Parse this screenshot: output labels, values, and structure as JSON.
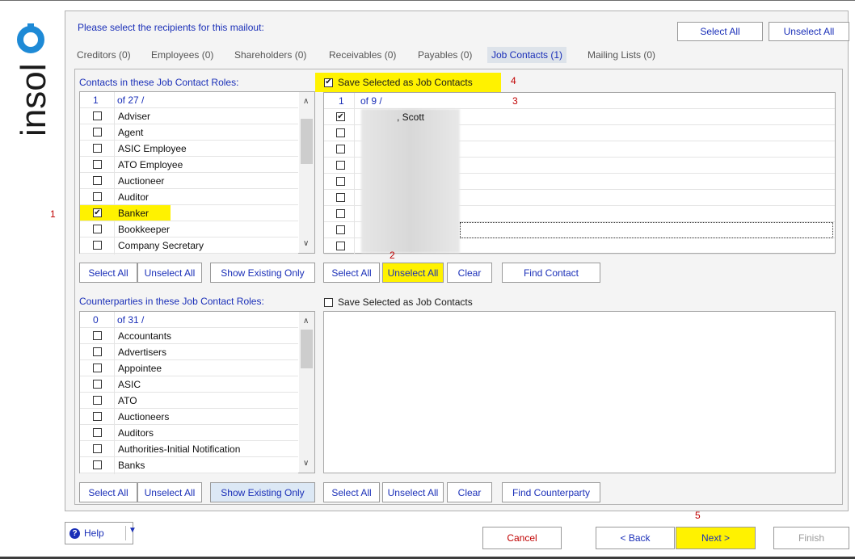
{
  "brand": {
    "logo_text": "insol6"
  },
  "header": {
    "prompt": "Please select the recipients for this mailout:",
    "select_all": "Select All",
    "unselect_all": "Unselect All"
  },
  "tabs": [
    {
      "label": "Creditors (0)",
      "active": false
    },
    {
      "label": "Employees (0)",
      "active": false
    },
    {
      "label": "Shareholders (0)",
      "active": false
    },
    {
      "label": "Receivables (0)",
      "active": false
    },
    {
      "label": "Payables (0)",
      "active": false
    },
    {
      "label": "Job Contacts (1)",
      "active": true
    },
    {
      "label": "Mailing Lists (0)",
      "active": false
    }
  ],
  "contacts_section": {
    "title": "Contacts in these Job Contact Roles:",
    "count": "1",
    "total": "of 27 /",
    "roles": [
      {
        "label": "Adviser",
        "checked": false
      },
      {
        "label": "Agent",
        "checked": false
      },
      {
        "label": "ASIC Employee",
        "checked": false
      },
      {
        "label": "ATO Employee",
        "checked": false
      },
      {
        "label": "Auctioneer",
        "checked": false
      },
      {
        "label": "Auditor",
        "checked": false
      },
      {
        "label": "Banker",
        "checked": true
      },
      {
        "label": "Bookkeeper",
        "checked": false
      },
      {
        "label": "Company Secretary",
        "checked": false
      }
    ],
    "buttons": {
      "select_all": "Select All",
      "unselect_all": "Unselect All",
      "show_existing": "Show Existing Only"
    }
  },
  "contacts_right": {
    "save_label": "Save Selected as Job Contacts",
    "save_checked": true,
    "count": "1",
    "total": "of 9 /",
    "first_contact": ", Scott",
    "buttons": {
      "select_all": "Select All",
      "unselect_all": "Unselect All",
      "clear": "Clear",
      "find": "Find Contact"
    }
  },
  "counterparties_section": {
    "title": "Counterparties in these Job Contact Roles:",
    "count": "0",
    "total": "of 31 /",
    "roles": [
      {
        "label": "Accountants"
      },
      {
        "label": "Advertisers"
      },
      {
        "label": "Appointee"
      },
      {
        "label": "ASIC"
      },
      {
        "label": "ATO"
      },
      {
        "label": "Auctioneers"
      },
      {
        "label": "Auditors"
      },
      {
        "label": "Authorities-Initial Notification"
      },
      {
        "label": "Banks"
      }
    ],
    "buttons": {
      "select_all": "Select All",
      "unselect_all": "Unselect All",
      "show_existing": "Show Existing Only"
    }
  },
  "counterparties_right": {
    "save_label": "Save Selected as Job Contacts",
    "save_checked": false,
    "buttons": {
      "select_all": "Select All",
      "unselect_all": "Unselect All",
      "clear": "Clear",
      "find": "Find Counterparty"
    }
  },
  "footer": {
    "help": "Help",
    "cancel": "Cancel",
    "back": "< Back",
    "next": "Next >",
    "finish": "Finish"
  },
  "annotations": {
    "n1": "1",
    "n2": "2",
    "n3": "3",
    "n4": "4",
    "n5": "5"
  },
  "colors": {
    "link_blue": "#1a2fb8",
    "highlight_yellow": "#fff200",
    "annotation_red": "#c00000",
    "logo_blue": "#1e8ad6"
  }
}
